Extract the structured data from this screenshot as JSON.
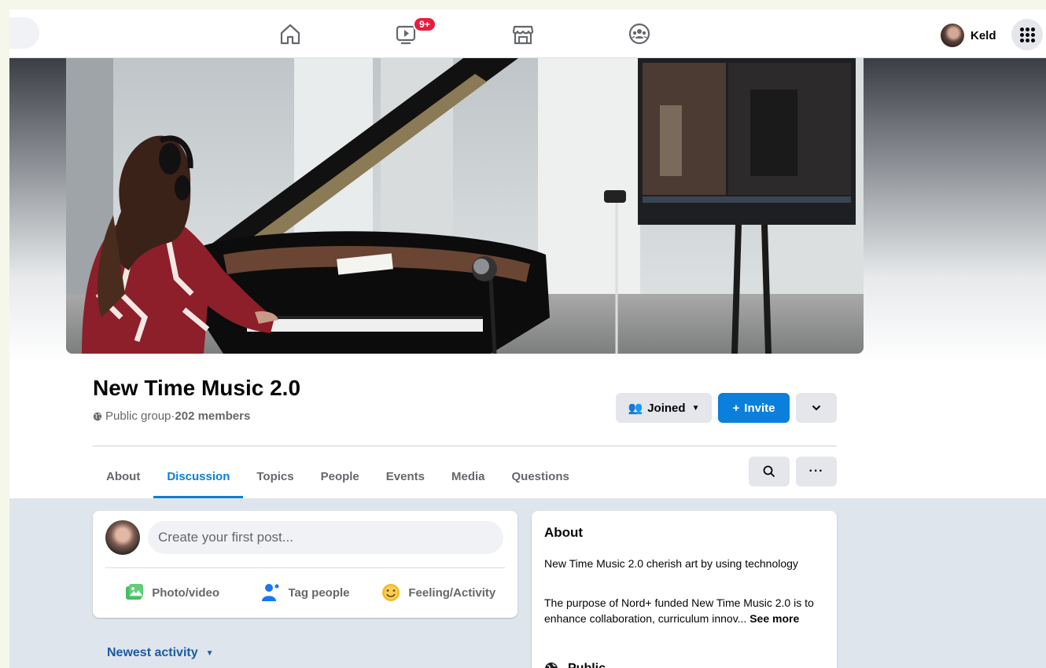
{
  "topnav": {
    "icons": [
      "home-icon",
      "watch-icon",
      "marketplace-icon",
      "groups-icon"
    ],
    "watch_badge": "9+",
    "profile_name": "Keld",
    "menu_icon": "grid-menu-icon"
  },
  "group": {
    "name": "New Time Music 2.0",
    "privacy": "Public group",
    "separator": " · ",
    "members": "202 members",
    "joined_label": "Joined",
    "invite_label": "Invite",
    "invite_glyph": "+"
  },
  "tabs": [
    {
      "label": "About",
      "active": false
    },
    {
      "label": "Discussion",
      "active": true
    },
    {
      "label": "Topics",
      "active": false
    },
    {
      "label": "People",
      "active": false
    },
    {
      "label": "Events",
      "active": false
    },
    {
      "label": "Media",
      "active": false
    },
    {
      "label": "Questions",
      "active": false
    }
  ],
  "composer": {
    "placeholder": "Create your first post...",
    "actions": [
      "Photo/video",
      "Tag people",
      "Feeling/Activity"
    ]
  },
  "feed": {
    "sort_label": "Newest activity"
  },
  "about": {
    "title": "About",
    "p1": "New Time Music 2.0 cherish art by using technology",
    "p2": "The purpose of Nord+ funded New Time Music 2.0 is to enhance collaboration, curriculum innov...",
    "see_more": "See more",
    "privacy_label": "Public"
  },
  "colors": {
    "accent": "#0a7fdc",
    "badge": "#e41e3f",
    "content_bg": "#dfe5ec"
  }
}
